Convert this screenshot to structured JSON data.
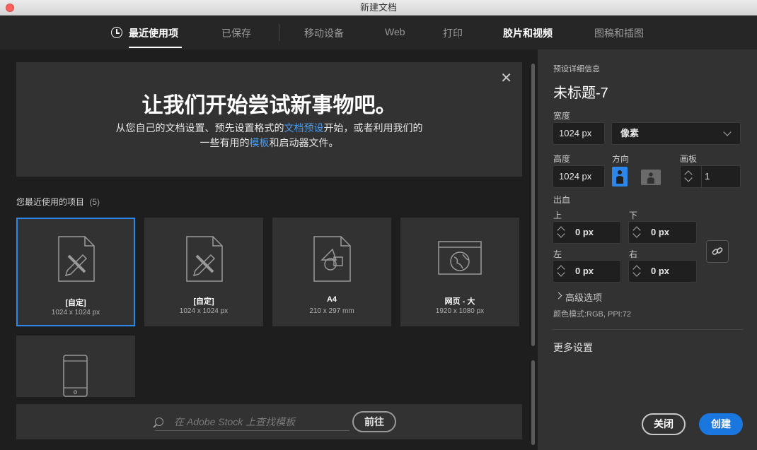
{
  "window": {
    "title": "新建文档"
  },
  "tabs": [
    {
      "label": "最近使用项"
    },
    {
      "label": "已保存"
    },
    {
      "label": "移动设备"
    },
    {
      "label": "Web"
    },
    {
      "label": "打印"
    },
    {
      "label": "胶片和视频"
    },
    {
      "label": "图稿和插图"
    }
  ],
  "welcome": {
    "close_glyph": "✕",
    "title": "让我们开始尝试新事物吧。",
    "line1_a": "从您自己的文档设置、预先设置格式的",
    "line1_link": "文档预设",
    "line1_b": "开始，或者利用我们的",
    "line2_a": "一些有用的",
    "line2_link": "模板",
    "line2_b": "和启动器文件。"
  },
  "recent": {
    "label": "您最近使用的项目",
    "count": "(5)",
    "items": [
      {
        "name": "[自定]",
        "size": "1024 x 1024 px",
        "icon": "custom-doc-icon"
      },
      {
        "name": "[自定]",
        "size": "1024 x 1024 px",
        "icon": "custom-doc-icon"
      },
      {
        "name": "A4",
        "size": "210 x 297 mm",
        "icon": "print-doc-icon"
      },
      {
        "name": "网页 - 大",
        "size": "1920 x 1080 px",
        "icon": "web-doc-icon"
      },
      {
        "name": "",
        "size": "",
        "icon": "mobile-doc-icon"
      }
    ]
  },
  "stock": {
    "placeholder": "在 Adobe Stock 上查找模板",
    "go_label": "前往"
  },
  "preset": {
    "section_label": "预设详细信息",
    "name": "未标题-7",
    "width_label": "宽度",
    "width_value": "1024 px",
    "unit_value": "像素",
    "height_label": "高度",
    "height_value": "1024 px",
    "orientation_label": "方向",
    "artboards_label": "画板",
    "artboards_value": "1",
    "bleed_label": "出血",
    "bleed_top_label": "上",
    "bleed_top_value": "0 px",
    "bleed_bottom_label": "下",
    "bleed_bottom_value": "0 px",
    "bleed_left_label": "左",
    "bleed_left_value": "0 px",
    "bleed_right_label": "右",
    "bleed_right_value": "0 px",
    "advanced_label": "高级选项",
    "color_mode": "颜色模式:RGB, PPI:72",
    "more_settings": "更多设置"
  },
  "actions": {
    "close_label": "关闭",
    "create_label": "创建"
  },
  "colors": {
    "accent": "#2d86ea",
    "create_button": "#1b77e0",
    "link": "#4b9bef"
  }
}
